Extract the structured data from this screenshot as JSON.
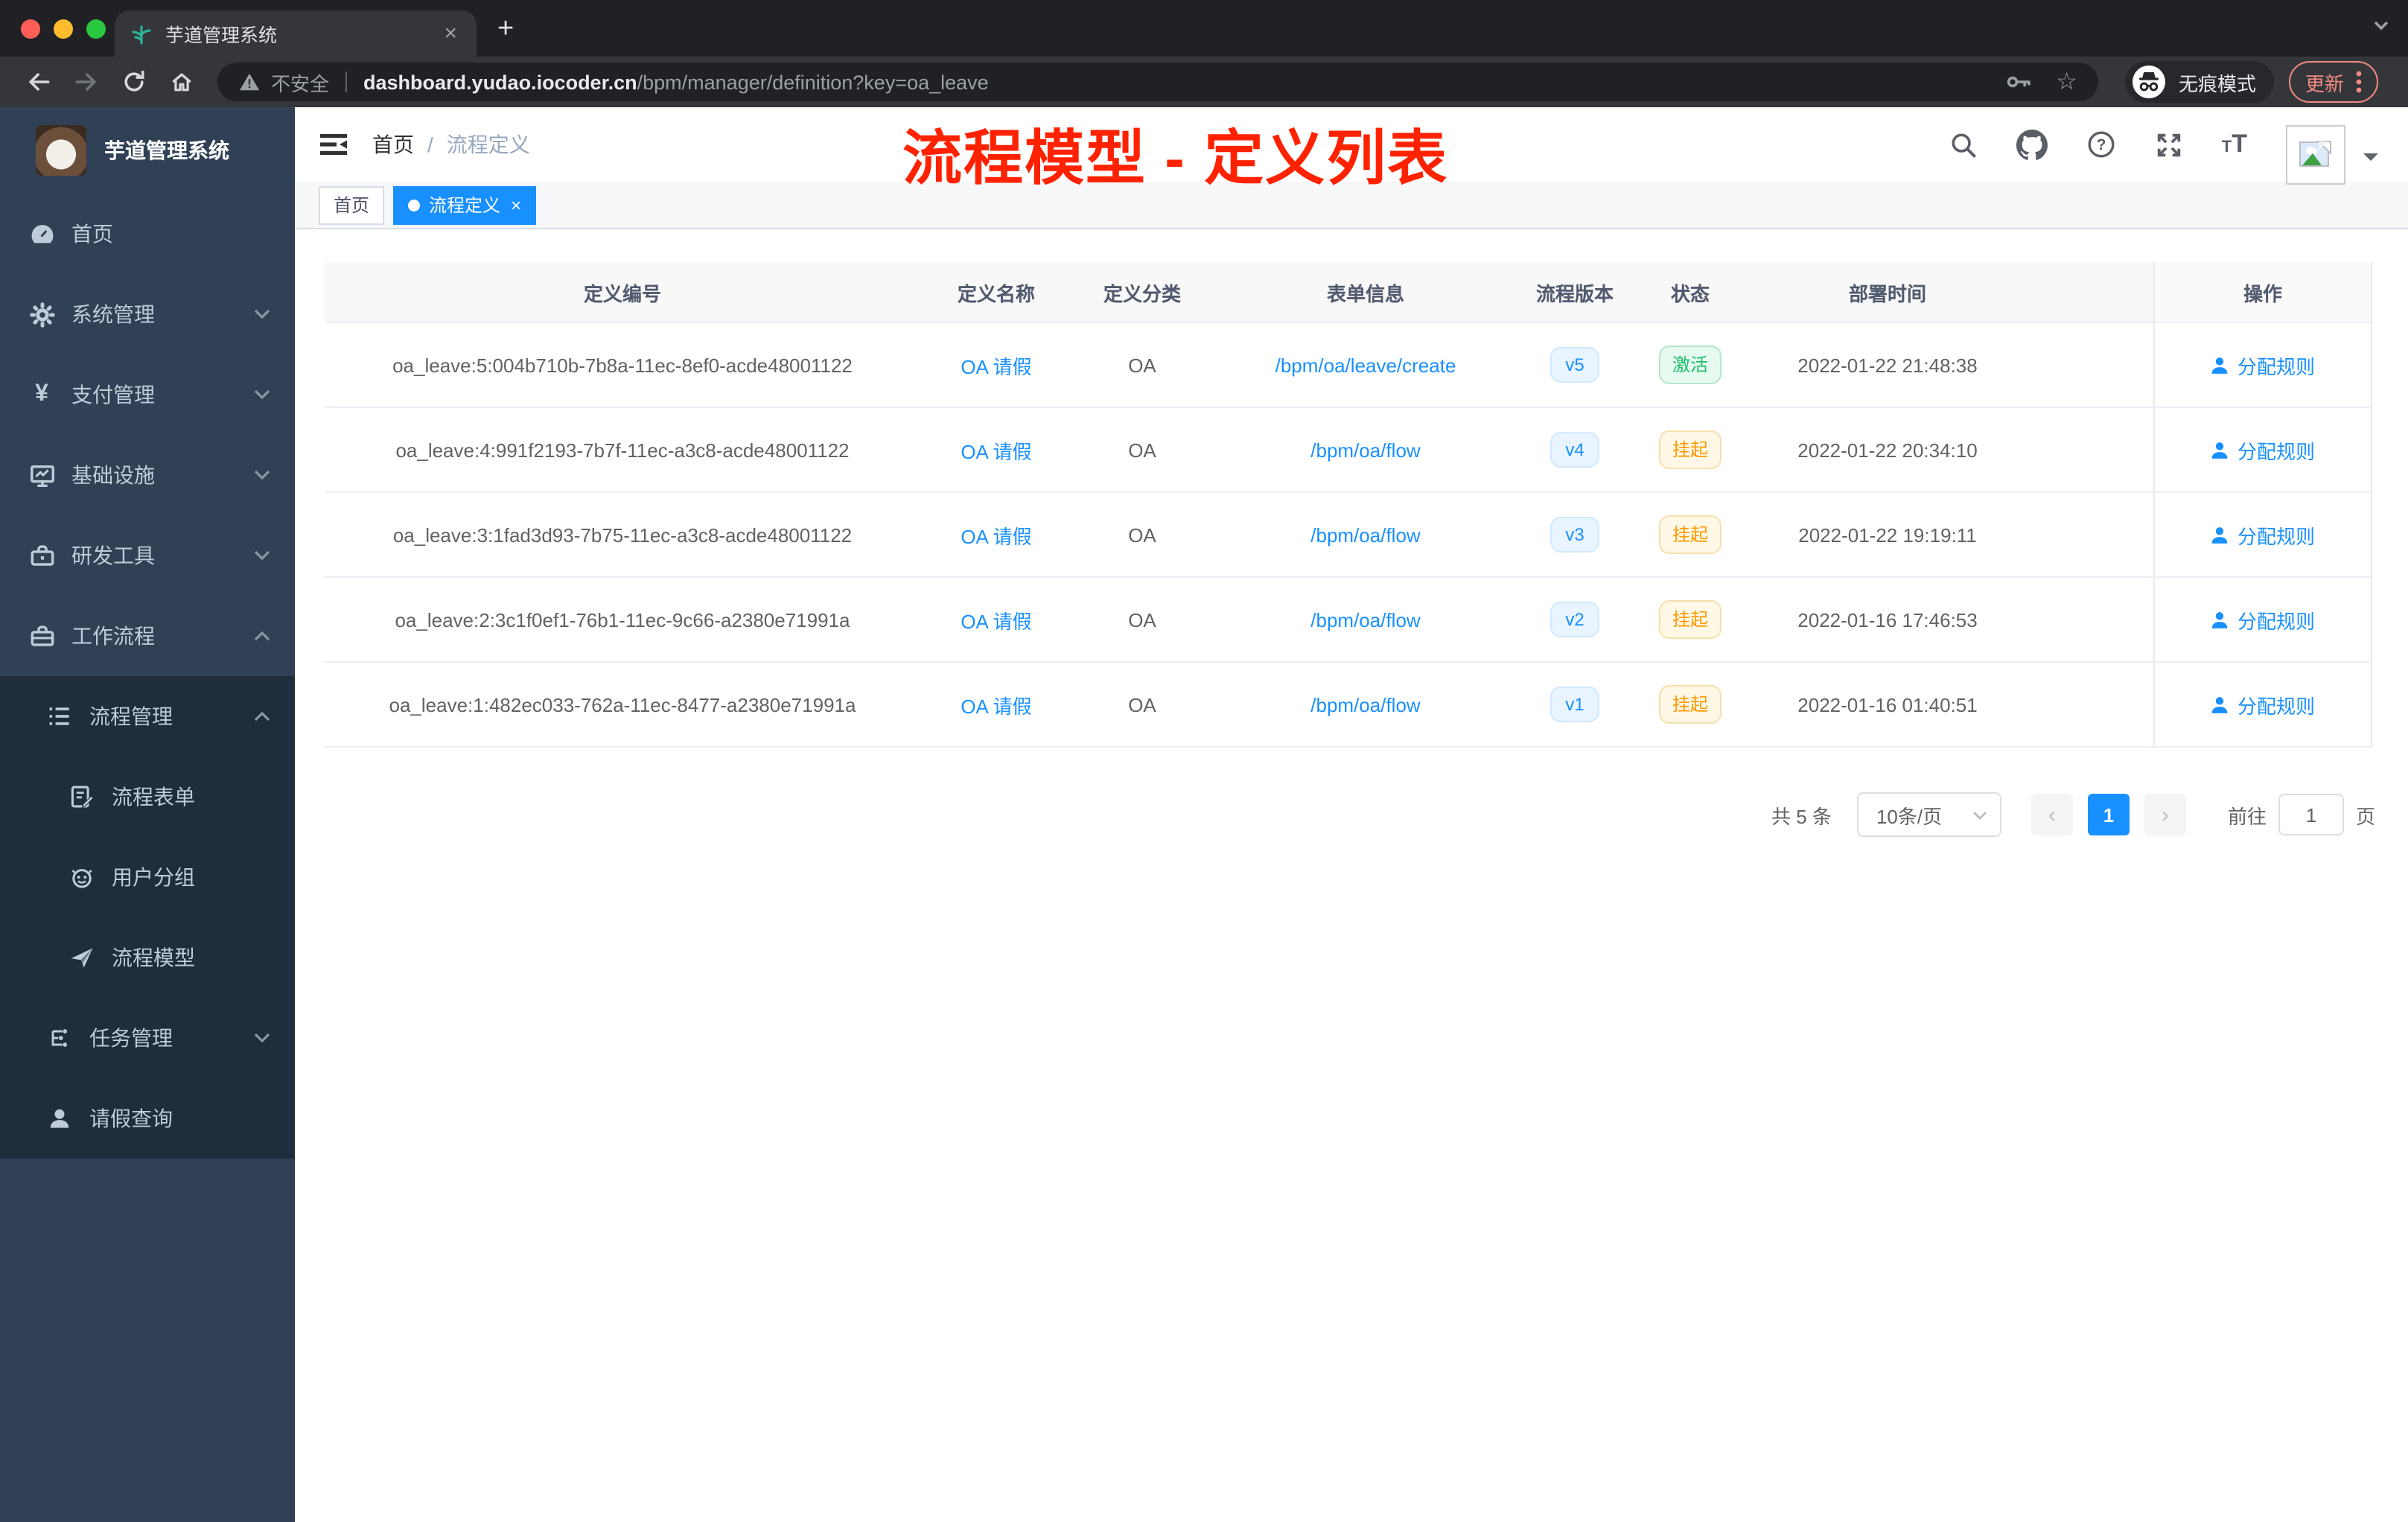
{
  "browser": {
    "tab_title": "芋道管理系统",
    "close_tab": "×",
    "new_tab": "+",
    "security_label": "不安全",
    "url_host": "dashboard.yudao.iocoder.cn",
    "url_path": "/bpm/manager/definition?key=oa_leave",
    "star_icon": "☆",
    "incognito_label": "无痕模式",
    "update_label": "更新"
  },
  "sidebar": {
    "app_title": "芋道管理系统",
    "items": [
      {
        "label": "首页",
        "icon": "dashboard-icon"
      },
      {
        "label": "系统管理",
        "icon": "gear-icon",
        "chevron": "down"
      },
      {
        "label": "支付管理",
        "icon": "yen-icon",
        "chevron": "down",
        "glyph": "¥"
      },
      {
        "label": "基础设施",
        "icon": "monitor-icon",
        "chevron": "down"
      },
      {
        "label": "研发工具",
        "icon": "toolbox-icon",
        "chevron": "down"
      },
      {
        "label": "工作流程",
        "icon": "briefcase-icon",
        "chevron": "up"
      },
      {
        "label": "流程管理",
        "icon": "list-tree-icon",
        "chevron": "up"
      },
      {
        "label": "流程表单",
        "icon": "form-icon"
      },
      {
        "label": "用户分组",
        "icon": "robot-icon"
      },
      {
        "label": "流程模型",
        "icon": "paper-plane-icon"
      },
      {
        "label": "任务管理",
        "icon": "org-tree-icon",
        "chevron": "down"
      },
      {
        "label": "请假查询",
        "icon": "user-icon"
      }
    ]
  },
  "navbar": {
    "breadcrumb_home": "首页",
    "breadcrumb_sep": "/",
    "breadcrumb_current": "流程定义",
    "annotation": "流程模型 - 定义列表"
  },
  "tags": [
    {
      "label": "首页"
    },
    {
      "label": "流程定义",
      "close": "×"
    }
  ],
  "table": {
    "columns": [
      "定义编号",
      "定义名称",
      "定义分类",
      "表单信息",
      "流程版本",
      "状态",
      "部署时间",
      "操作"
    ],
    "rows": [
      {
        "id": "oa_leave:5:004b710b-7b8a-11ec-8ef0-acde48001122",
        "name": "OA 请假",
        "category": "OA",
        "form": "/bpm/oa/leave/create",
        "version": "v5",
        "status": "激活",
        "deployed": "2022-01-22 21:48:38",
        "action": "分配规则"
      },
      {
        "id": "oa_leave:4:991f2193-7b7f-11ec-a3c8-acde48001122",
        "name": "OA 请假",
        "category": "OA",
        "form": "/bpm/oa/flow",
        "version": "v4",
        "status": "挂起",
        "deployed": "2022-01-22 20:34:10",
        "action": "分配规则"
      },
      {
        "id": "oa_leave:3:1fad3d93-7b75-11ec-a3c8-acde48001122",
        "name": "OA 请假",
        "category": "OA",
        "form": "/bpm/oa/flow",
        "version": "v3",
        "status": "挂起",
        "deployed": "2022-01-22 19:19:11",
        "action": "分配规则"
      },
      {
        "id": "oa_leave:2:3c1f0ef1-76b1-11ec-9c66-a2380e71991a",
        "name": "OA 请假",
        "category": "OA",
        "form": "/bpm/oa/flow",
        "version": "v2",
        "status": "挂起",
        "deployed": "2022-01-16 17:46:53",
        "action": "分配规则"
      },
      {
        "id": "oa_leave:1:482ec033-762a-11ec-8477-a2380e71991a",
        "name": "OA 请假",
        "category": "OA",
        "form": "/bpm/oa/flow",
        "version": "v1",
        "status": "挂起",
        "deployed": "2022-01-16 01:40:51",
        "action": "分配规则"
      }
    ]
  },
  "pagination": {
    "total": "共 5 条",
    "page_size": "10条/页",
    "prev": "‹",
    "current": "1",
    "next": "›",
    "goto_label": "前往",
    "goto_value": "1",
    "unit": "页"
  },
  "colors": {
    "primary": "#1890ff",
    "success": "#19be6b",
    "warning": "#ff9900",
    "annotation_red": "#ff2200",
    "sidebar_bg": "#304156",
    "submenu_bg": "#1f2d3d"
  }
}
